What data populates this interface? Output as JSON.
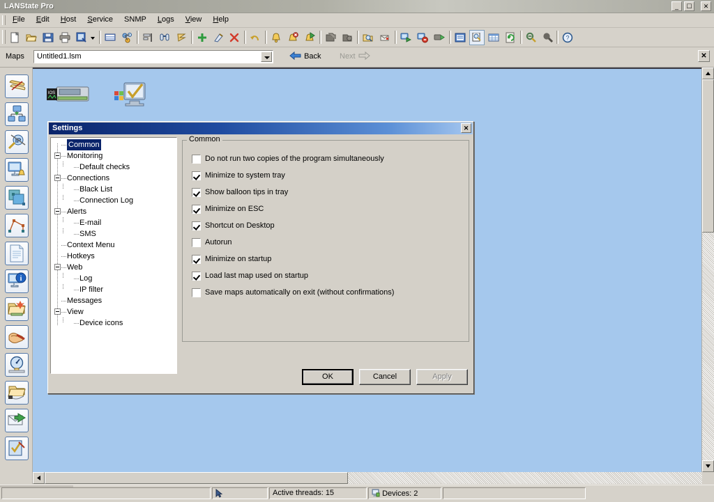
{
  "window": {
    "title": "LANState Pro",
    "buttons": {
      "minimize": "_",
      "maximize": "❐",
      "close": "✕"
    }
  },
  "menu": {
    "items": [
      {
        "label": "File",
        "accel": "F"
      },
      {
        "label": "Edit",
        "accel": "E"
      },
      {
        "label": "Host",
        "accel": "H"
      },
      {
        "label": "Service",
        "accel": "S"
      },
      {
        "label": "SNMP",
        "accel": ""
      },
      {
        "label": "Logs",
        "accel": "L"
      },
      {
        "label": "View",
        "accel": "V"
      },
      {
        "label": "Help",
        "accel": "H"
      }
    ]
  },
  "toolbar": {
    "buttons": [
      {
        "name": "new-map-icon",
        "tip": "New"
      },
      {
        "name": "open-map-icon",
        "tip": "Open"
      },
      {
        "name": "save-map-icon",
        "tip": "Save"
      },
      {
        "name": "print-icon",
        "tip": "Print"
      },
      {
        "name": "export-image-icon",
        "tip": "Export"
      },
      {
        "name": "export-dropdown-icon",
        "tip": "Export options"
      },
      {
        "name": "device-list-icon",
        "tip": "Device list"
      },
      {
        "name": "network-scan-icon",
        "tip": "Network scan"
      },
      {
        "name": "align-icon",
        "tip": "Align"
      },
      {
        "name": "find-icon",
        "tip": "Find"
      },
      {
        "name": "script-icon",
        "tip": "Script"
      },
      {
        "name": "add-device-icon",
        "tip": "Add device"
      },
      {
        "name": "edit-device-icon",
        "tip": "Edit device"
      },
      {
        "name": "delete-device-icon",
        "tip": "Delete device"
      },
      {
        "name": "undo-icon",
        "tip": "Undo"
      },
      {
        "name": "alert-bell-icon",
        "tip": "Alerts"
      },
      {
        "name": "alert-disable-icon",
        "tip": "Disable alerts"
      },
      {
        "name": "alert-forward-icon",
        "tip": "Forward alerts"
      },
      {
        "name": "copy-icon",
        "tip": "Copy"
      },
      {
        "name": "paste-icon",
        "tip": "Paste"
      },
      {
        "name": "folder-search-icon",
        "tip": "Browse"
      },
      {
        "name": "mail-icon",
        "tip": "Mail"
      },
      {
        "name": "start-monitor-icon",
        "tip": "Start monitoring"
      },
      {
        "name": "stop-monitor-icon",
        "tip": "Stop monitoring"
      },
      {
        "name": "run-icon",
        "tip": "Run"
      },
      {
        "name": "report-icon",
        "tip": "Report"
      },
      {
        "name": "inspect-icon",
        "tip": "Inspect"
      },
      {
        "name": "table-icon",
        "tip": "Table view"
      },
      {
        "name": "refresh-icon",
        "tip": "Refresh"
      },
      {
        "name": "zoom-out-icon",
        "tip": "Zoom out"
      },
      {
        "name": "zoom-in-icon",
        "tip": "Zoom in"
      },
      {
        "name": "help-icon",
        "tip": "Help"
      }
    ]
  },
  "mapsbar": {
    "label": "Maps",
    "current_map": "Untitled1.lsm",
    "back_label": "Back",
    "next_label": "Next",
    "close_glyph": "✕"
  },
  "sidebar": {
    "items": [
      {
        "name": "sidebar-scroll-icon",
        "tip": "Map properties"
      },
      {
        "name": "sidebar-network-icon",
        "tip": "Network devices"
      },
      {
        "name": "sidebar-ip-scan-icon",
        "tip": "IP scanner"
      },
      {
        "name": "sidebar-monitor-alert-icon",
        "tip": "Monitor alerts"
      },
      {
        "name": "sidebar-shapes-icon",
        "tip": "Shapes"
      },
      {
        "name": "sidebar-link-icon",
        "tip": "Links"
      },
      {
        "name": "sidebar-document-icon",
        "tip": "Document"
      },
      {
        "name": "sidebar-info-icon",
        "tip": "Information"
      },
      {
        "name": "sidebar-folder-new-icon",
        "tip": "New group"
      },
      {
        "name": "sidebar-pointer-icon",
        "tip": "Select"
      },
      {
        "name": "sidebar-gauge-icon",
        "tip": "Performance"
      },
      {
        "name": "sidebar-folder-open-icon",
        "tip": "Open folder"
      },
      {
        "name": "sidebar-send-mail-icon",
        "tip": "Send mail"
      },
      {
        "name": "sidebar-checklist-icon",
        "tip": "Checks"
      }
    ]
  },
  "map": {
    "devices": [
      {
        "name": "device-router",
        "label": "",
        "icon": "router-icon"
      },
      {
        "name": "device-host",
        "label": "",
        "icon": "computer-check-icon"
      }
    ]
  },
  "statusbar": {
    "panels": [
      {
        "name": "status-progress",
        "text": ""
      },
      {
        "name": "status-cursor",
        "text": ""
      },
      {
        "name": "status-threads",
        "text": "Active threads: 15"
      },
      {
        "name": "status-devices",
        "text": "Devices: 2"
      },
      {
        "name": "status-extra",
        "text": ""
      }
    ]
  },
  "dialog": {
    "title": "Settings",
    "close_glyph": "✕",
    "tree": [
      {
        "label": "Common",
        "level": 1,
        "expander": false,
        "selected": true
      },
      {
        "label": "Monitoring",
        "level": 1,
        "expander": true,
        "selected": false
      },
      {
        "label": "Default checks",
        "level": 2,
        "expander": false,
        "selected": false
      },
      {
        "label": "Connections",
        "level": 1,
        "expander": true,
        "selected": false
      },
      {
        "label": "Black List",
        "level": 2,
        "expander": false,
        "selected": false
      },
      {
        "label": "Connection Log",
        "level": 2,
        "expander": false,
        "selected": false
      },
      {
        "label": "Alerts",
        "level": 1,
        "expander": true,
        "selected": false
      },
      {
        "label": "E-mail",
        "level": 2,
        "expander": false,
        "selected": false
      },
      {
        "label": "SMS",
        "level": 2,
        "expander": false,
        "selected": false
      },
      {
        "label": "Context Menu",
        "level": 1,
        "expander": false,
        "selected": false
      },
      {
        "label": "Hotkeys",
        "level": 1,
        "expander": false,
        "selected": false
      },
      {
        "label": "Web",
        "level": 1,
        "expander": true,
        "selected": false
      },
      {
        "label": "Log",
        "level": 2,
        "expander": false,
        "selected": false
      },
      {
        "label": "IP filter",
        "level": 2,
        "expander": false,
        "selected": false
      },
      {
        "label": "Messages",
        "level": 1,
        "expander": false,
        "selected": false
      },
      {
        "label": "View",
        "level": 1,
        "expander": true,
        "selected": false
      },
      {
        "label": "Device icons",
        "level": 2,
        "expander": false,
        "selected": false
      }
    ],
    "group_legend": "Common",
    "checkboxes": [
      {
        "label": "Do not run two copies of the program simultaneously",
        "checked": false
      },
      {
        "label": "Minimize to system tray",
        "checked": true
      },
      {
        "label": "Show balloon tips in tray",
        "checked": true
      },
      {
        "label": "Minimize on ESC",
        "checked": true
      },
      {
        "label": "Shortcut on Desktop",
        "checked": true
      },
      {
        "label": "Autorun",
        "checked": false
      },
      {
        "label": "Minimize on startup",
        "checked": true
      },
      {
        "label": "Load last map used on startup",
        "checked": true
      },
      {
        "label": "Save maps automatically on exit (without confirmations)",
        "checked": false
      }
    ],
    "buttons": [
      {
        "name": "ok-button",
        "label": "OK",
        "default": true,
        "disabled": false
      },
      {
        "name": "cancel-button",
        "label": "Cancel",
        "default": false,
        "disabled": false
      },
      {
        "name": "apply-button",
        "label": "Apply",
        "default": false,
        "disabled": true
      }
    ]
  },
  "colors": {
    "desktop": "#a5c8ed",
    "chrome": "#d4d0c8",
    "title_active": "#0a246a",
    "selection": "#0a246a"
  }
}
